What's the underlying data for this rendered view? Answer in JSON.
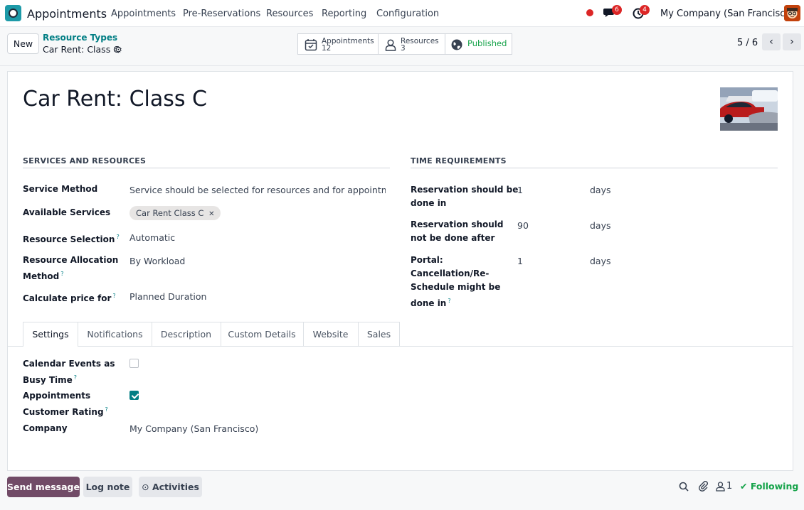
{
  "navbar": {
    "app_name": "Appointments",
    "menu": [
      "Appointments",
      "Pre-Reservations",
      "Resources",
      "Reporting",
      "Configuration"
    ],
    "messages_count": "6",
    "activities_count": "4",
    "company": "My Company (San Francisco)"
  },
  "control": {
    "new_label": "New",
    "breadcrumb_parent": "Resource Types",
    "breadcrumb_current": "Car Rent: Class C",
    "smart_appointments_label": "Appointments",
    "smart_appointments_value": "12",
    "smart_resources_label": "Resources",
    "smart_resources_value": "3",
    "smart_published_label": "Published",
    "pager": "5 / 6"
  },
  "record": {
    "title": "Car Rent: Class C",
    "services_section": "SERVICES AND RESOURCES",
    "time_section": "TIME REQUIREMENTS",
    "service_method_label": "Service Method",
    "service_method_value": "Service should be selected for resources and for appointment",
    "available_services_label": "Available Services",
    "available_services_tag": "Car Rent Class C",
    "resource_selection_label": "Resource Selection",
    "resource_selection_value": "Automatic",
    "allocation_label_1": "Resource Allocation",
    "allocation_label_2": "Method",
    "allocation_value": "By Workload",
    "price_label": "Calculate price for",
    "price_value": "Planned Duration",
    "res_done_label_1": "Reservation should be",
    "res_done_label_2": "done in",
    "res_done_value": "1",
    "res_done_unit": "days",
    "res_not_label_1": "Reservation should",
    "res_not_label_2": "not be done after",
    "res_not_value": "90",
    "res_not_unit": "days",
    "portal_label_1": "Portal:",
    "portal_label_2": "Cancellation/Re-",
    "portal_label_3": "Schedule might be",
    "portal_label_4": "done in",
    "portal_value": "1",
    "portal_unit": "days"
  },
  "tabs": [
    "Settings",
    "Notifications",
    "Description",
    "Custom Details",
    "Website",
    "Sales"
  ],
  "settings": {
    "busy_label_1": "Calendar Events as",
    "busy_label_2": "Busy Time",
    "busy_checked": false,
    "rating_label_1": "Appointments",
    "rating_label_2": "Customer Rating",
    "rating_checked": true,
    "company_label": "Company",
    "company_value": "My Company (San Francisco)"
  },
  "chatter": {
    "send_message": "Send message",
    "log_note": "Log note",
    "activities": "Activities",
    "followers_count": "1",
    "following": "Following"
  },
  "colors": {
    "brand": "#714b67",
    "accent": "#017e84",
    "following": "#16a34a",
    "badge": "#dc2626"
  }
}
